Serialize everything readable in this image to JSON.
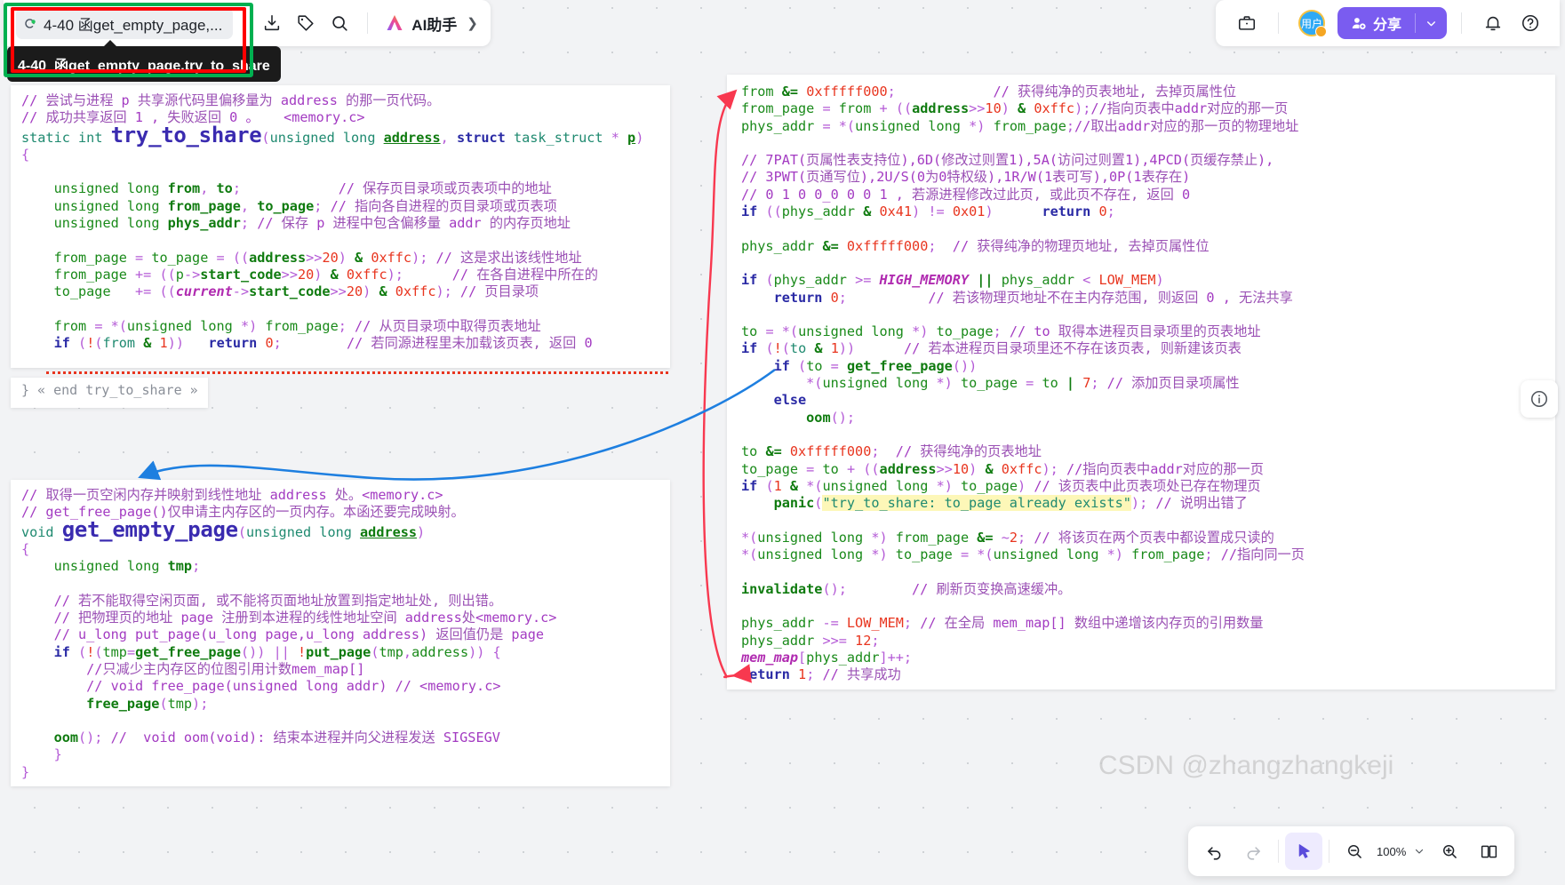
{
  "topbar": {
    "doc_title": "4-40 函get_empty_page,...",
    "tooltip_code": "4-40",
    "tooltip_title": "函get_empty_page,try_to_share",
    "ai_label": "AI助手",
    "avatar_text": "用户",
    "share_label": "分享",
    "icons": {
      "sync": "sync-icon",
      "export": "export-icon",
      "tag": "tag-icon",
      "search": "search-icon",
      "chevron_right": "chevron-right-icon",
      "briefcase": "briefcase-icon",
      "share_caret": "chevron-down-icon",
      "bell": "bell-icon",
      "help": "help-icon"
    }
  },
  "bottombar": {
    "zoom_level": "100%",
    "icons": {
      "undo": "undo-icon",
      "redo": "redo-icon",
      "cursor": "cursor-icon",
      "zoom_out": "zoom-out-icon",
      "zoom_caret": "chevron-down-icon",
      "zoom_in": "zoom-in-icon",
      "fit": "fit-view-icon"
    }
  },
  "watermark": "CSDN @zhangzhangkeji",
  "info_button": "info-icon",
  "cards": {
    "try_to_share": {
      "lines": [
        "// 尝试与进程 p 共享源代码里偏移量为 address 的那一页代码。",
        "// 成功共享返回 1 ， 失败返回 0 。   <memory.c>",
        "static int try_to_share(unsigned long address, struct task_struct * p)",
        "{",
        "",
        "    unsigned long from, to;            // 保存页目录项或页表项中的地址",
        "    unsigned long from_page, to_page; // 指向各自进程的页目录项或页表项",
        "    unsigned long phys_addr; // 保存 p 进程中包含偏移量 addr 的内存页地址",
        "",
        "    from_page = to_page = ((address>>20) & 0xffc); // 这是求出该线性地址",
        "    from_page += ((p->start_code>>20) & 0xffc);      // 在各自进程中所在的",
        "    to_page   += ((current->start_code>>20) & 0xffc); // 页目录项",
        "",
        "    from = *(unsigned long *) from_page; // 从页目录项中取得页表地址",
        "    if (!(from & 1))   return 0;        // 若同源进程里未加载该页表, 返回 0"
      ]
    },
    "end_marker": {
      "text": "} « end try_to_share »"
    },
    "get_empty_page": {
      "lines": [
        "// 取得一页空闲内存并映射到线性地址 address 处。<memory.c>",
        "// get_free_page()仅申请主内存区的一页内存。本函还要完成映射。",
        "void get_empty_page(unsigned long address)",
        "{",
        "    unsigned long tmp;",
        "",
        "    // 若不能取得空闲页面, 或不能将页面地址放置到指定地址处, 则出错。",
        "    // 把物理页的地址 page 注册到本进程的线性地址空间 address处<memory.c>",
        "    // u_long put_page(u_long page,u_long address) 返回值仍是 page",
        "    if (!(tmp=get_free_page()) || !put_page(tmp,address)) {",
        "        //只减少主内存区的位图引用计数mem_map[]",
        "        // void free_page(unsigned long addr) // <memory.c>",
        "        free_page(tmp);",
        "",
        "    oom(); //  void oom(void): 结束本进程并向父进程发送 SIGSEGV",
        "    }",
        "}"
      ]
    },
    "share_body": {
      "lines": [
        "from &= 0xfffff000;            // 获得纯净的页表地址, 去掉页属性位",
        "from_page = from + ((address>>10) & 0xffc);//指向页表中addr对应的那一页",
        "phys_addr = *(unsigned long *) from_page;//取出addr对应的那一页的物理地址",
        "",
        "// 7PAT(页属性表支持位),6D(修改过则置1),5A(访问过则置1),4PCD(页缓存禁止),",
        "// 3PWT(页通写位),2U/S(0为0特权级),1R/W(1表可写),0P(1表存在)",
        "// 0 1 0 0_0 0 0 1 , 若源进程修改过此页, 或此页不存在, 返回 0",
        "if ((phys_addr & 0x41) != 0x01)      return 0;",
        "",
        "phys_addr &= 0xfffff000;  // 获得纯净的物理页地址, 去掉页属性位",
        "",
        "if (phys_addr >= HIGH_MEMORY || phys_addr < LOW_MEM)",
        "    return 0;          // 若该物理页地址不在主内存范围, 则返回 0 , 无法共享",
        "",
        "to = *(unsigned long *) to_page; // to 取得本进程页目录项里的页表地址",
        "if (!(to & 1))      // 若本进程页目录项里还不存在该页表, 则新建该页表",
        "    if (to = get_free_page())",
        "        *(unsigned long *) to_page = to | 7; // 添加页目录项属性",
        "    else",
        "        oom();",
        "",
        "to &= 0xfffff000;  // 获得纯净的页表地址",
        "to_page = to + ((address>>10) & 0xffc); //指向页表中addr对应的那一页",
        "if (1 & *(unsigned long *) to_page) // 该页表中此页表项处已存在物理页",
        "    panic(\"try_to_share: to_page already exists\"); // 说明出错了",
        "",
        "*(unsigned long *) from_page &= ~2; // 将该页在两个页表中都设置成只读的",
        "*(unsigned long *) to_page = *(unsigned long *) from_page; //指向同一页",
        "",
        "invalidate();        // 刷新页变换高速缓冲。",
        "",
        "phys_addr -= LOW_MEM; // 在全局 mem_map[] 数组中递增该内存页的引用数量",
        "phys_addr >>= 12;",
        "mem_map[phys_addr]++;",
        "return 1; // 共享成功"
      ]
    }
  },
  "colors": {
    "accent": "#7a5cf0",
    "green_box": "#00b050",
    "red_box": "#ff0000",
    "arrow_red": "#f8384f",
    "arrow_blue": "#1e7fe0",
    "comment": "#a33bc2",
    "code_green": "#1a8a1a",
    "keyword": "#2a2aa5",
    "number": "#e8351f",
    "highlight": "#fdf7b8"
  }
}
